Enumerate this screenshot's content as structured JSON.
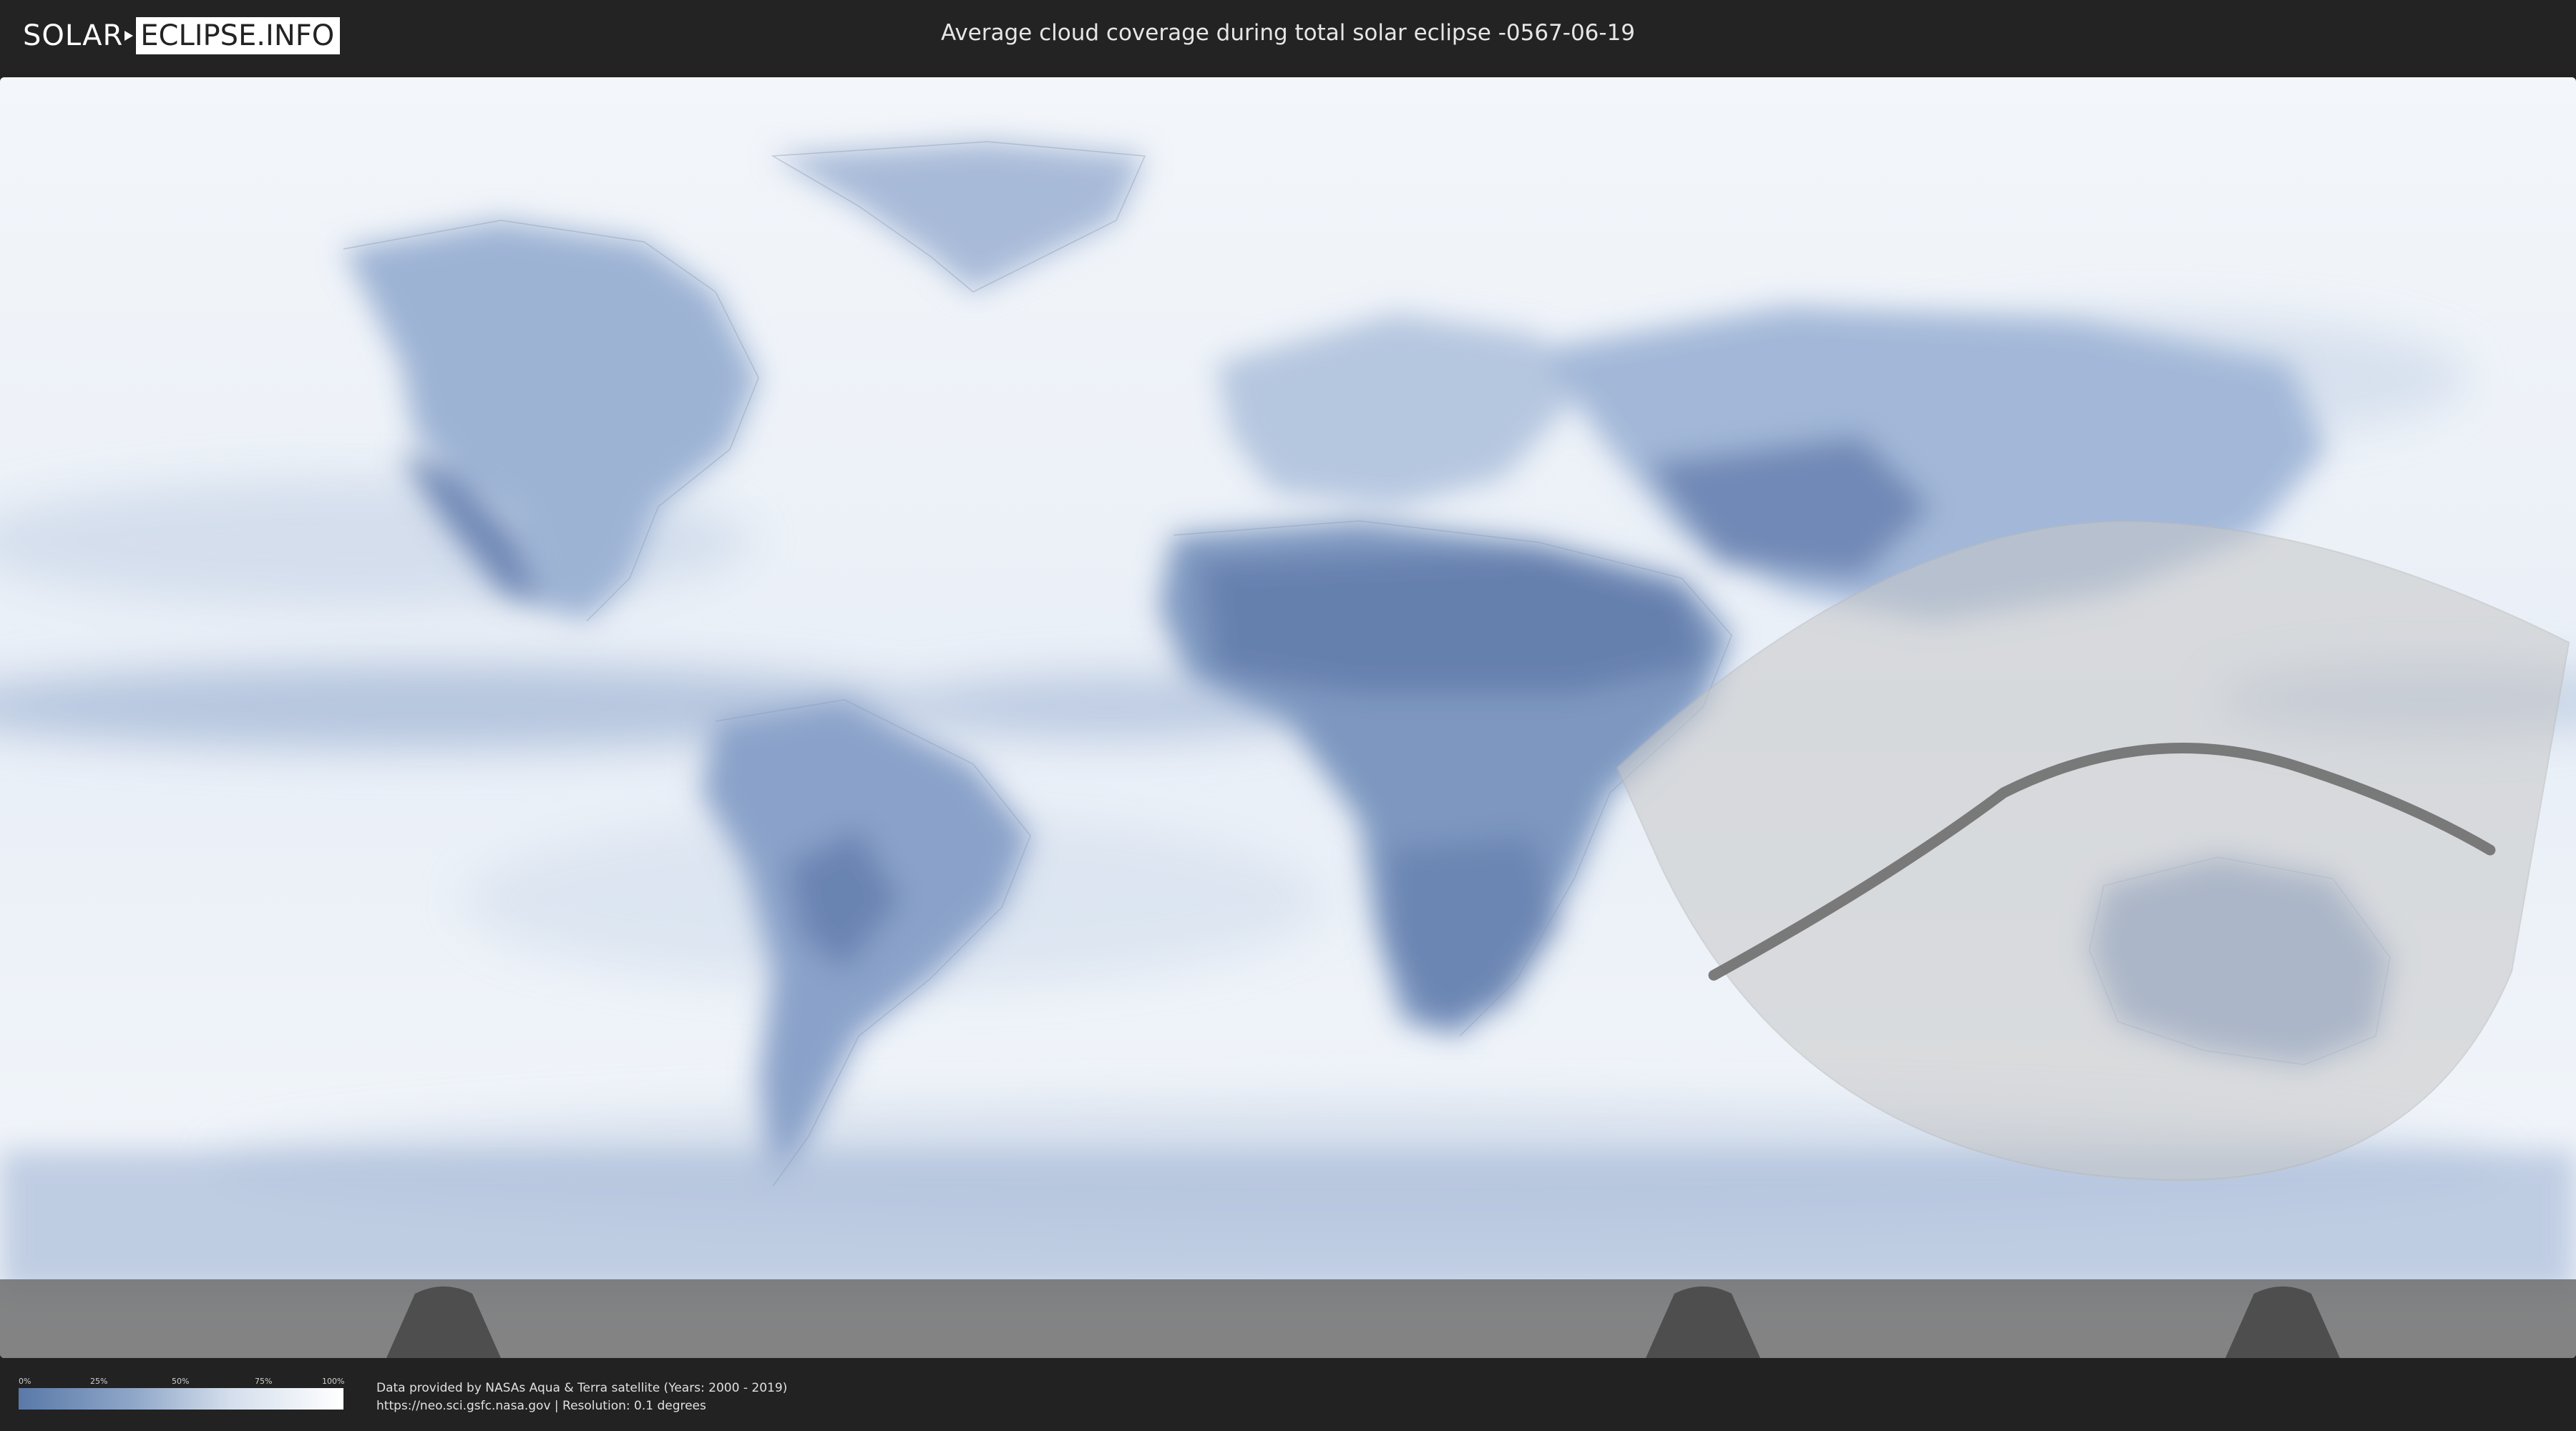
{
  "header": {
    "logo_part1": "SOLAR",
    "logo_part2": "ECLIPSE.INFO",
    "title": "Average cloud coverage during total solar eclipse -0567-06-19"
  },
  "legend": {
    "ticks": [
      "0%",
      "25%",
      "50%",
      "75%",
      "100%"
    ],
    "gradient_colors": [
      "#5a79a8",
      "#ffffff"
    ]
  },
  "footer": {
    "source_line1": "Data provided by NASAs Aqua & Terra satellite (Years: 2000 - 2019)",
    "source_line2": "https://neo.sci.gsfc.nasa.gov | Resolution: 0.1 degrees"
  },
  "colors": {
    "background": "#222222",
    "ocean_clouds": "#eef3f9",
    "clear_land": "#6c86b3",
    "eclipse_zone": "#c8c8c8",
    "totality_path": "#6e6e6e"
  }
}
